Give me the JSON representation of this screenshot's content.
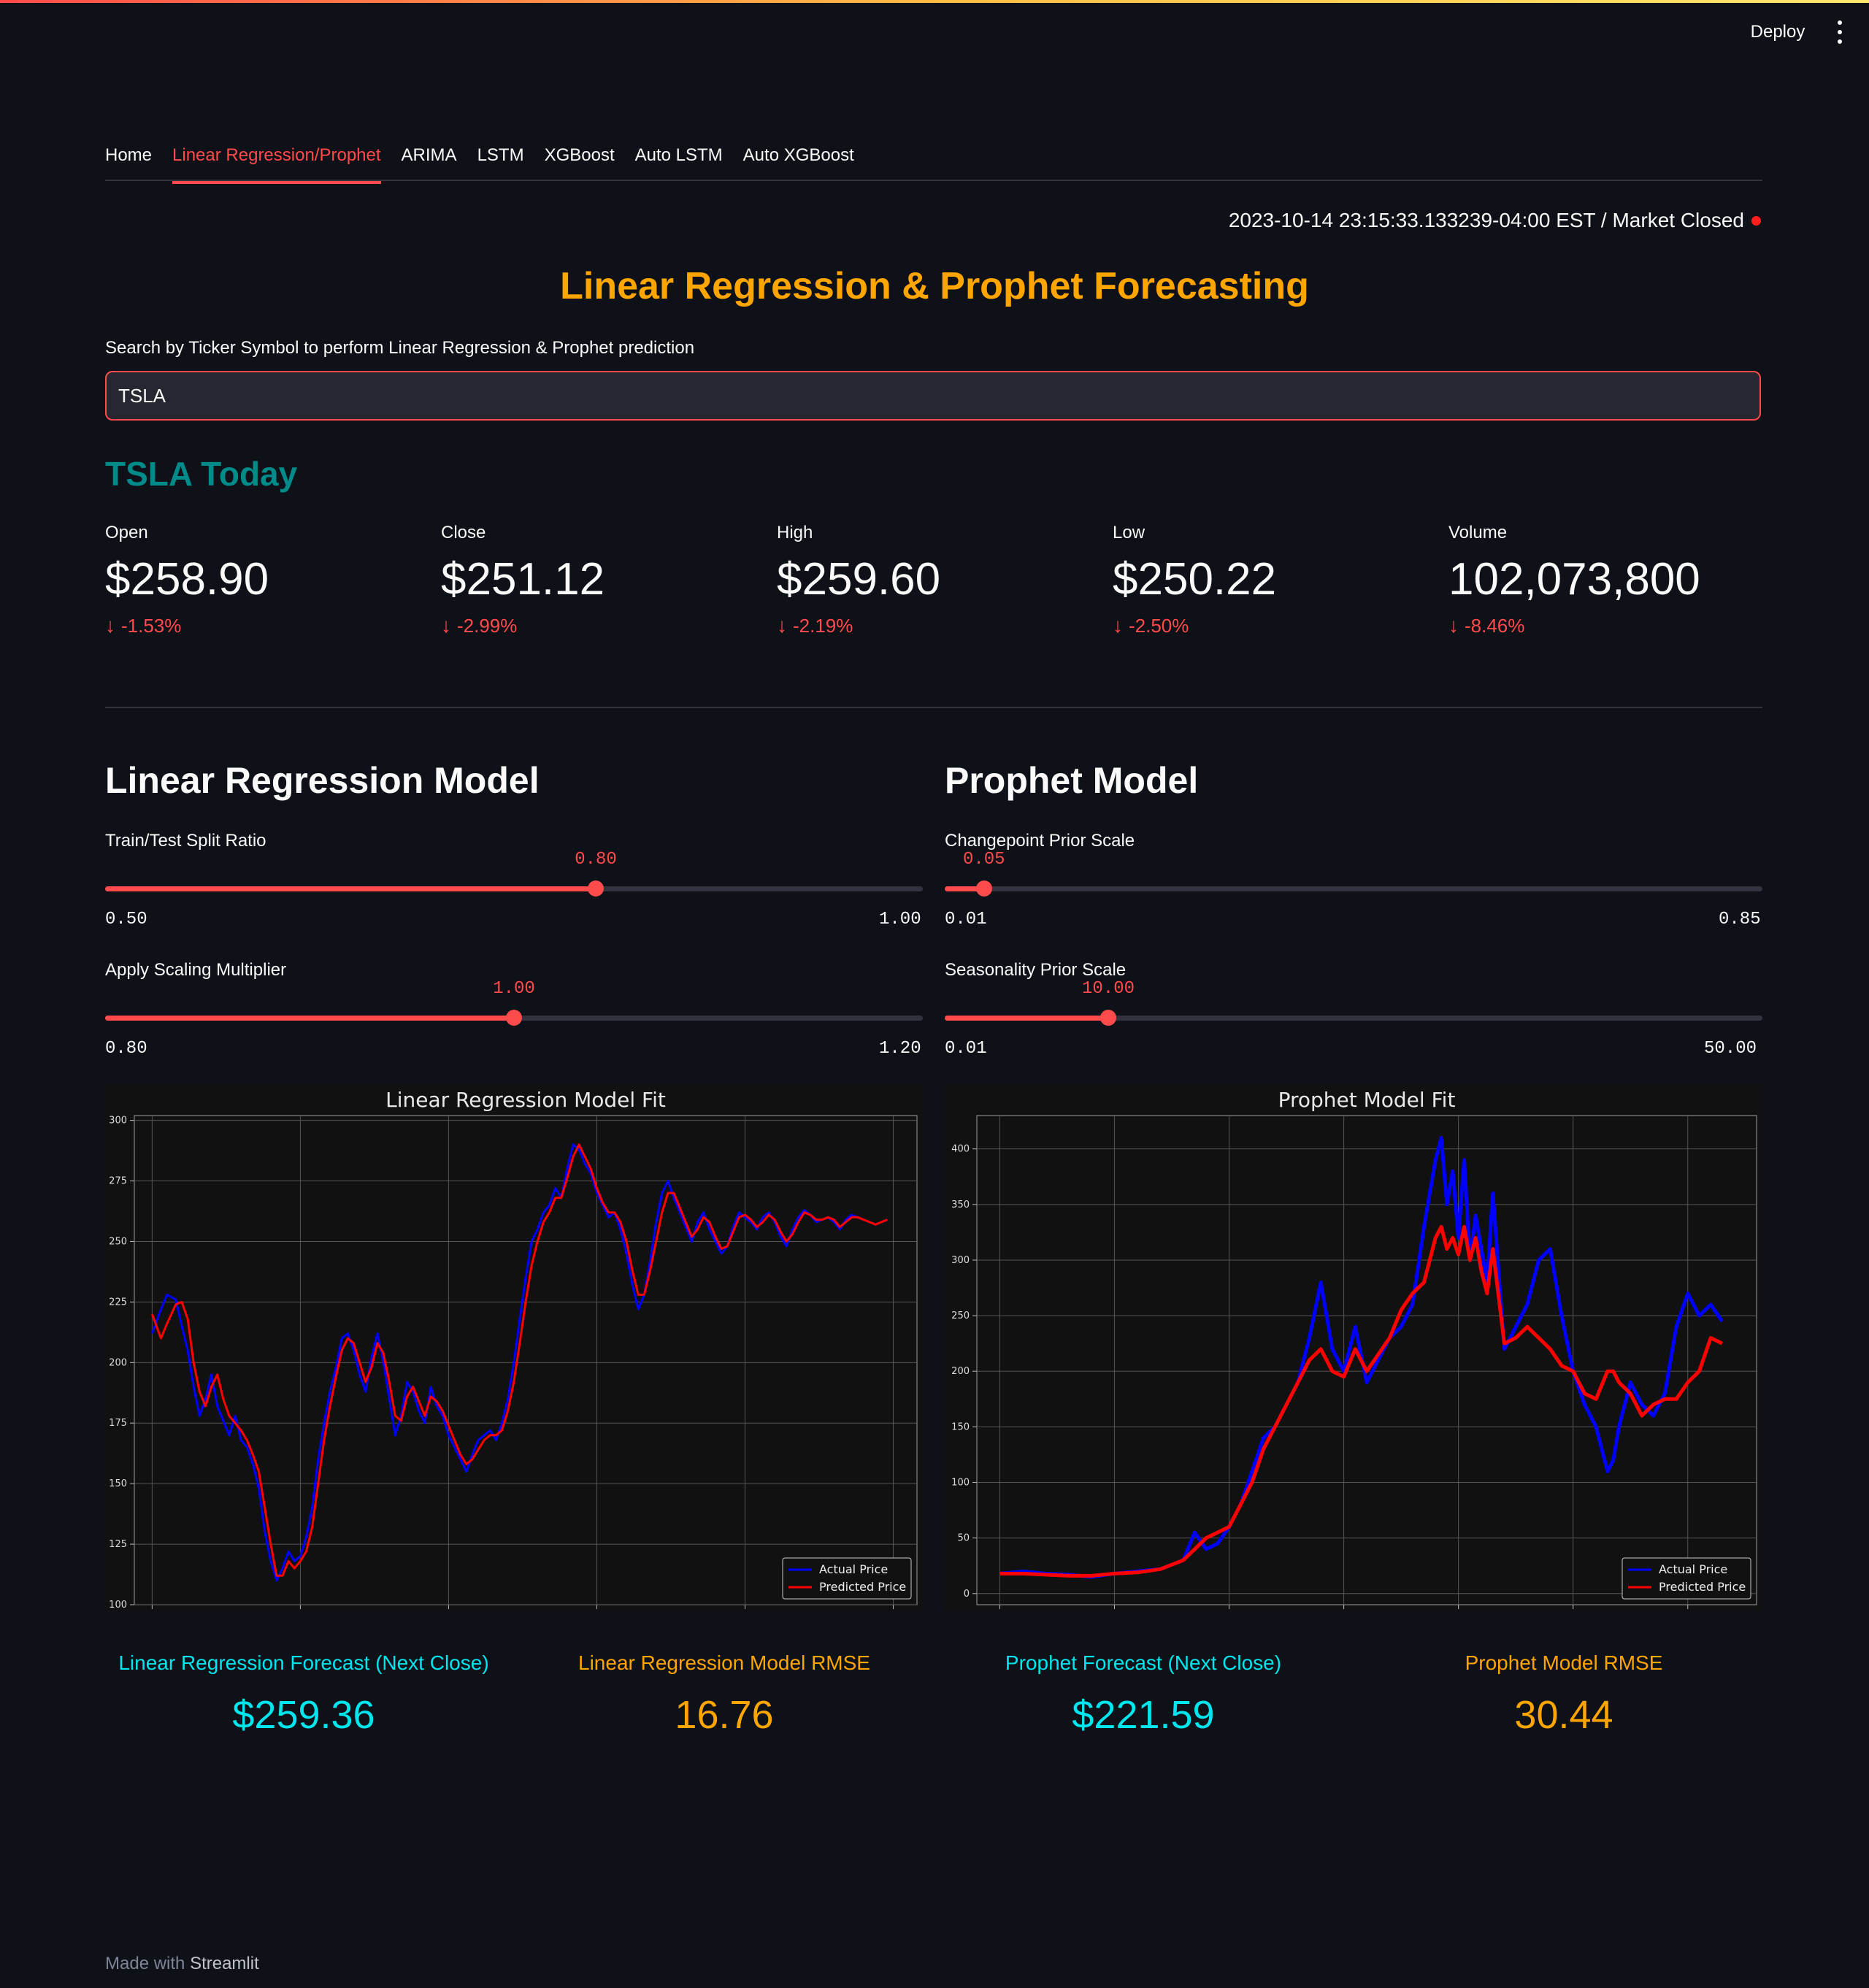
{
  "header": {
    "deploy_label": "Deploy"
  },
  "tabs": [
    {
      "label": "Home"
    },
    {
      "label": "Linear Regression/Prophet",
      "active": true
    },
    {
      "label": "ARIMA"
    },
    {
      "label": "LSTM"
    },
    {
      "label": "XGBoost"
    },
    {
      "label": "Auto LSTM"
    },
    {
      "label": "Auto XGBoost"
    }
  ],
  "status": {
    "timestamp": "2023-10-14 23:15:33.133239-04:00 EST / Market Closed",
    "dot_color": "#ff1f1f"
  },
  "title": "Linear Regression & Prophet Forecasting",
  "search": {
    "label": "Search by Ticker Symbol to perform Linear Regression & Prophet prediction",
    "value": "TSLA"
  },
  "today": {
    "heading": "TSLA Today",
    "metrics": [
      {
        "label": "Open",
        "value": "$258.90",
        "delta": "-1.53%"
      },
      {
        "label": "Close",
        "value": "$251.12",
        "delta": "-2.99%"
      },
      {
        "label": "High",
        "value": "$259.60",
        "delta": "-2.19%"
      },
      {
        "label": "Low",
        "value": "$250.22",
        "delta": "-2.50%"
      },
      {
        "label": "Volume",
        "value": "102,073,800",
        "delta": "-8.46%"
      }
    ]
  },
  "linreg": {
    "heading": "Linear Regression Model",
    "sliders": [
      {
        "label": "Train/Test Split Ratio",
        "value": "0.80",
        "min": "0.50",
        "max": "1.00",
        "fraction": 0.6
      },
      {
        "label": "Apply Scaling Multiplier",
        "value": "1.00",
        "min": "0.80",
        "max": "1.20",
        "fraction": 0.5
      }
    ],
    "forecast_label": "Linear Regression Forecast (Next Close)",
    "forecast_value": "$259.36",
    "rmse_label": "Linear Regression Model RMSE",
    "rmse_value": "16.76"
  },
  "prophet": {
    "heading": "Prophet Model",
    "sliders": [
      {
        "label": "Changepoint Prior Scale",
        "value": "0.05",
        "min": "0.01",
        "max": "0.85",
        "fraction": 0.048
      },
      {
        "label": "Seasonality Prior Scale",
        "value": "10.00",
        "min": "0.01",
        "max": "50.00",
        "fraction": 0.2
      }
    ],
    "forecast_label": "Prophet Forecast (Next Close)",
    "forecast_value": "$221.59",
    "rmse_label": "Prophet Model RMSE",
    "rmse_value": "30.44"
  },
  "chart_data": [
    {
      "type": "line",
      "title": "Linear Regression Model Fit",
      "xlim": [
        -6,
        258
      ],
      "ylim": [
        100,
        302
      ],
      "xticks": [
        0,
        50,
        100,
        150,
        200,
        250
      ],
      "yticks": [
        100,
        125,
        150,
        175,
        200,
        225,
        250,
        275,
        300
      ],
      "grid": true,
      "legend": "bottom-right",
      "series": [
        {
          "name": "Actual Price",
          "color": "#0000ff",
          "x": [
            0,
            3,
            5,
            8,
            10,
            12,
            14,
            16,
            18,
            20,
            22,
            24,
            26,
            28,
            30,
            32,
            34,
            36,
            38,
            40,
            42,
            44,
            46,
            48,
            50,
            52,
            54,
            56,
            58,
            60,
            62,
            64,
            66,
            68,
            70,
            72,
            74,
            76,
            78,
            80,
            82,
            84,
            86,
            88,
            90,
            92,
            94,
            96,
            98,
            100,
            102,
            104,
            106,
            108,
            110,
            112,
            114,
            116,
            118,
            120,
            122,
            124,
            126,
            128,
            130,
            132,
            134,
            136,
            138,
            140,
            142,
            144,
            146,
            148,
            150,
            152,
            154,
            156,
            158,
            160,
            162,
            164,
            166,
            168,
            170,
            172,
            174,
            176,
            178,
            180,
            182,
            184,
            186,
            188,
            190,
            192,
            194,
            196,
            198,
            200,
            202,
            204,
            206,
            208,
            210,
            212,
            214,
            216,
            218,
            220,
            222,
            224,
            226,
            228,
            230,
            232,
            234,
            236,
            238,
            240,
            242,
            244,
            246,
            248
          ],
          "y": [
            212,
            222,
            228,
            226,
            215,
            205,
            190,
            178,
            185,
            195,
            182,
            176,
            170,
            178,
            168,
            165,
            158,
            148,
            130,
            118,
            110,
            115,
            122,
            118,
            120,
            128,
            140,
            160,
            175,
            188,
            198,
            210,
            212,
            205,
            195,
            188,
            202,
            212,
            200,
            185,
            170,
            178,
            192,
            188,
            180,
            175,
            190,
            182,
            178,
            170,
            165,
            160,
            155,
            162,
            168,
            170,
            172,
            168,
            175,
            185,
            200,
            218,
            235,
            250,
            255,
            262,
            265,
            272,
            268,
            280,
            290,
            288,
            282,
            278,
            270,
            265,
            260,
            262,
            255,
            245,
            232,
            222,
            228,
            242,
            258,
            270,
            275,
            268,
            262,
            256,
            250,
            258,
            262,
            255,
            250,
            245,
            248,
            256,
            262,
            260,
            258,
            255,
            260,
            262,
            258,
            252,
            248,
            255,
            260,
            263,
            261,
            258,
            259,
            260,
            258,
            255,
            259,
            261,
            260,
            259,
            258,
            257,
            258,
            259
          ]
        },
        {
          "name": "Predicted Price",
          "color": "#ff0000",
          "x": [
            0,
            3,
            5,
            8,
            10,
            12,
            14,
            16,
            18,
            20,
            22,
            24,
            26,
            28,
            30,
            32,
            34,
            36,
            38,
            40,
            42,
            44,
            46,
            48,
            50,
            52,
            54,
            56,
            58,
            60,
            62,
            64,
            66,
            68,
            70,
            72,
            74,
            76,
            78,
            80,
            82,
            84,
            86,
            88,
            90,
            92,
            94,
            96,
            98,
            100,
            102,
            104,
            106,
            108,
            110,
            112,
            114,
            116,
            118,
            120,
            122,
            124,
            126,
            128,
            130,
            132,
            134,
            136,
            138,
            140,
            142,
            144,
            146,
            148,
            150,
            152,
            154,
            156,
            158,
            160,
            162,
            164,
            166,
            168,
            170,
            172,
            174,
            176,
            178,
            180,
            182,
            184,
            186,
            188,
            190,
            192,
            194,
            196,
            198,
            200,
            202,
            204,
            206,
            208,
            210,
            212,
            214,
            216,
            218,
            220,
            222,
            224,
            226,
            228,
            230,
            232,
            234,
            236,
            238,
            240,
            242,
            244,
            246,
            248
          ],
          "y": [
            220,
            210,
            216,
            224,
            225,
            218,
            200,
            188,
            182,
            190,
            195,
            185,
            178,
            175,
            172,
            168,
            162,
            155,
            140,
            125,
            112,
            112,
            118,
            115,
            118,
            122,
            132,
            150,
            168,
            182,
            194,
            205,
            210,
            208,
            200,
            192,
            198,
            208,
            204,
            192,
            178,
            176,
            186,
            190,
            184,
            178,
            186,
            184,
            180,
            174,
            168,
            162,
            158,
            160,
            164,
            168,
            170,
            170,
            172,
            180,
            192,
            208,
            225,
            240,
            250,
            258,
            262,
            268,
            268,
            276,
            285,
            290,
            285,
            280,
            272,
            266,
            262,
            262,
            258,
            250,
            238,
            228,
            228,
            238,
            250,
            262,
            270,
            270,
            264,
            258,
            252,
            255,
            260,
            258,
            252,
            247,
            248,
            254,
            260,
            261,
            259,
            256,
            258,
            261,
            259,
            254,
            250,
            253,
            258,
            262,
            261,
            259,
            259,
            260,
            259,
            256,
            258,
            260,
            260,
            259,
            258,
            257,
            258,
            259
          ]
        }
      ]
    },
    {
      "type": "line",
      "title": "Prophet Model Fit",
      "xlim": [
        -40,
        1320
      ],
      "ylim": [
        -10,
        430
      ],
      "xticks": [
        0,
        200,
        400,
        600,
        800,
        1000,
        1200
      ],
      "yticks": [
        0,
        50,
        100,
        150,
        200,
        250,
        300,
        350,
        400
      ],
      "grid": true,
      "legend": "bottom-right",
      "series": [
        {
          "name": "Actual Price",
          "color": "#0000ff",
          "x": [
            0,
            40,
            80,
            120,
            160,
            200,
            240,
            280,
            320,
            340,
            360,
            380,
            400,
            420,
            440,
            460,
            480,
            500,
            520,
            540,
            560,
            580,
            600,
            620,
            640,
            660,
            680,
            700,
            720,
            740,
            760,
            770,
            780,
            790,
            800,
            810,
            820,
            830,
            840,
            850,
            860,
            880,
            900,
            920,
            940,
            960,
            980,
            1000,
            1020,
            1040,
            1060,
            1070,
            1080,
            1100,
            1120,
            1140,
            1160,
            1180,
            1200,
            1220,
            1240,
            1260
          ],
          "y": [
            18,
            20,
            18,
            17,
            15,
            18,
            20,
            22,
            30,
            55,
            40,
            45,
            60,
            80,
            110,
            140,
            150,
            170,
            190,
            230,
            280,
            220,
            200,
            240,
            190,
            210,
            230,
            240,
            260,
            330,
            390,
            410,
            350,
            380,
            320,
            390,
            300,
            340,
            310,
            280,
            360,
            220,
            240,
            260,
            300,
            310,
            250,
            200,
            170,
            150,
            110,
            120,
            150,
            190,
            170,
            160,
            180,
            240,
            270,
            250,
            260,
            245
          ]
        },
        {
          "name": "Predicted Price",
          "color": "#ff0000",
          "x": [
            0,
            40,
            80,
            120,
            160,
            200,
            240,
            280,
            320,
            340,
            360,
            380,
            400,
            420,
            440,
            460,
            480,
            500,
            520,
            540,
            560,
            580,
            600,
            620,
            640,
            660,
            680,
            700,
            720,
            740,
            760,
            770,
            780,
            790,
            800,
            810,
            820,
            830,
            840,
            850,
            860,
            880,
            900,
            920,
            940,
            960,
            980,
            1000,
            1020,
            1040,
            1060,
            1070,
            1080,
            1100,
            1120,
            1140,
            1160,
            1180,
            1200,
            1220,
            1240,
            1260
          ],
          "y": [
            18,
            18,
            17,
            16,
            16,
            18,
            19,
            22,
            30,
            40,
            50,
            55,
            60,
            80,
            100,
            130,
            150,
            170,
            190,
            210,
            220,
            200,
            195,
            220,
            200,
            215,
            230,
            255,
            270,
            280,
            320,
            330,
            310,
            320,
            305,
            330,
            300,
            320,
            290,
            270,
            310,
            225,
            230,
            240,
            230,
            220,
            205,
            200,
            180,
            175,
            200,
            200,
            190,
            180,
            160,
            170,
            175,
            175,
            190,
            200,
            230,
            225
          ]
        }
      ]
    }
  ]
}
